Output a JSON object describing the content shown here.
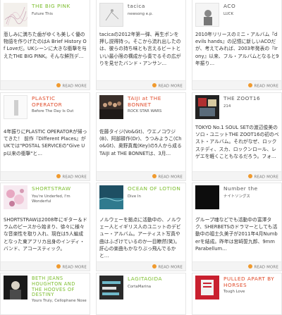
{
  "colors": {
    "accent": "#7bbd2c",
    "readmore_icon": "#f09a2e"
  },
  "readmore_label": "READ MORE",
  "cards": [
    {
      "title": "THE BIG PINK",
      "sub": "Future This",
      "desc": "悲しみに満ちた歯がゆくも美しく優の物語を作りげたのはA Brief History Of Loveだ。UKシーンに大きな衝撃を与えたTHE BIG PINK。そんな鮮烈デ…"
    },
    {
      "title": "tacica",
      "sub": "newsong e.p.",
      "desc": "tacicaの2012年第一弾、再生ポンを押し説得持っ。そこから流れ出したのは、彼らの持ち味とも言えるビートといい最小限の構成から奏でるその広がりを見せたバンド・アンサン…"
    },
    {
      "title": "ACO",
      "sub": "LUCK",
      "desc": "2010年リリースのミニ・アルバム『devils hands』の記憶に新しいACOだが、考えてみれば、2003年発表の『Irony』以来、フル・アルバムとなると9年振り…"
    },
    {
      "title": "PLASTIC OPERATOR",
      "sub": "Before The Day Is Out",
      "desc": "4年振りにPLASTIC OPERATORが帰ってきた！ 前作『Different Places』がUKでは\"POSTAL SERVICEの\"Give Up以来の衝撃\"と…"
    },
    {
      "title": "TAIJI at THE BONNET",
      "sub": "ROCK STAR WARS",
      "desc": "佐藤タイジ(Vo&Gt)、ウエノコウジ(B)、阿部耕作(Dr)、うつみようこ(Cho&Gt)、奥野真哉(Key)の5人から成るTAIJI at THE BONNETは、3月…"
    },
    {
      "title": "THE ZOOT16",
      "sub": "214",
      "desc": "TOKYO No.1 SOUL SETの渡辺俊美のソロ・ユニットTHE ZOOT16の初のベスト・アルバム。それがなぜ、ロックステディ、スカ、ロックンロール、レゲエを軽くこともなるだろう。フォ…"
    },
    {
      "title": "SHORTSTRAW",
      "sub": "You're Underfed, I'm Wonderful",
      "desc": "SHORTSTRAWは2008年にギター＆ドラムのピースから始まり、徐々に様々な音楽性を取り入れ、現在は5人編成となった東アフリカ出身のインディ・バンド、アコースティック。"
    },
    {
      "title": "OCEAN OF LOTION",
      "sub": "Dive In",
      "desc": "ノルウェーを拠点に活動中の、ノルウェー人とイギリス人のユニットのデビュー・アルバム。アーティスト写真や曲はふざけているのか一目瞭然(笑)。肝心の楽曲もかなりぶっ飛んでるかと…"
    },
    {
      "title": "Number the",
      "sub": "ナイトソングス",
      "desc": "グループ魂などでも活動中の富澤タク、SHERBETSのドラマーとしても活動中の福士久美子が2011年4月Numberを結成。昨年は宮崎誓九郎、9mm Parabellum…"
    },
    {
      "title": "BETH JEANS HOUGHTON AND THE HOOVES OF DESTINY",
      "sub": "Yours Truly, Cellophane Nose",
      "desc": ""
    },
    {
      "title": "LAGITAGIDA",
      "sub": "CortaMarina",
      "desc": ""
    },
    {
      "title": "PULLED APART BY HORSES",
      "sub": "Tough Love",
      "desc": ""
    }
  ]
}
